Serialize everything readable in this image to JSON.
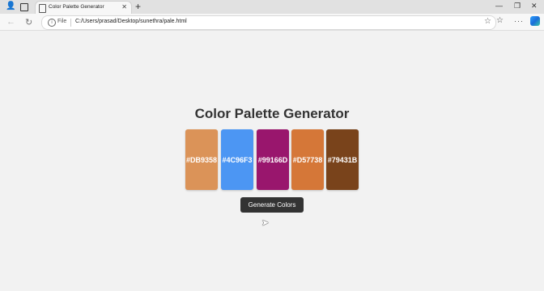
{
  "browser": {
    "tab_title": "Color Palette Generator",
    "address_label": "File",
    "url": "C:/Users/prasad/Desktop/sunethra/pale.html"
  },
  "app": {
    "title": "Color Palette Generator",
    "swatches": [
      {
        "label": "#DB9358",
        "color": "#DB9358"
      },
      {
        "label": "#4C96F3",
        "color": "#4C96F3"
      },
      {
        "label": "#99166D",
        "color": "#99166D"
      },
      {
        "label": "#D57738",
        "color": "#D57738"
      },
      {
        "label": "#79431B",
        "color": "#79431B"
      }
    ],
    "button_label": "Generate Colors"
  }
}
